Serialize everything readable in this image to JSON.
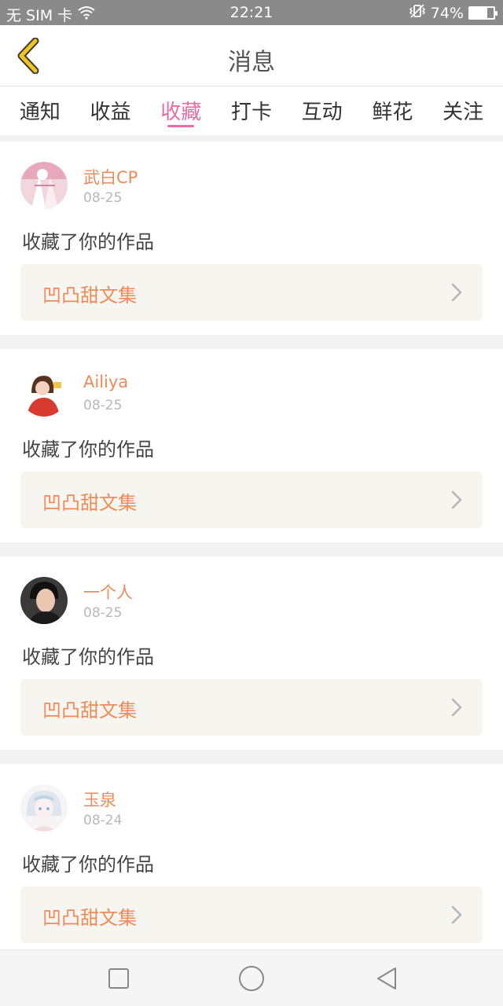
{
  "status_bar": {
    "carrier": "无 SIM 卡",
    "time": "22:21",
    "battery": "74%",
    "battery_level": 0.74,
    "icons": [
      "wifi-icon",
      "vibrate-icon",
      "battery-icon"
    ]
  },
  "header": {
    "title": "消息",
    "back_icon": "back-chevron-icon",
    "back_color": "#f2c51c"
  },
  "tabs": [
    {
      "label": "通知",
      "active": false
    },
    {
      "label": "收益",
      "active": false
    },
    {
      "label": "收藏",
      "active": true
    },
    {
      "label": "打卡",
      "active": false
    },
    {
      "label": "互动",
      "active": false
    },
    {
      "label": "鲜花",
      "active": false
    },
    {
      "label": "关注",
      "active": false
    }
  ],
  "colors": {
    "accent": "#e86ca8",
    "username": "#ef8a5b",
    "work_box_bg": "#f6f5ef"
  },
  "messages": [
    {
      "username": "武白CP",
      "date": "08-25",
      "action": "收藏了你的作品",
      "work_title": "凹凸甜文集"
    },
    {
      "username": "Ailiya",
      "date": "08-25",
      "action": "收藏了你的作品",
      "work_title": "凹凸甜文集"
    },
    {
      "username": "一个人",
      "date": "08-25",
      "action": "收藏了你的作品",
      "work_title": "凹凸甜文集"
    },
    {
      "username": "玉泉",
      "date": "08-24",
      "action": "收藏了你的作品",
      "work_title": "凹凸甜文集"
    }
  ],
  "nav_bar": {
    "buttons": [
      "recent-apps-icon",
      "home-icon",
      "back-icon"
    ]
  }
}
